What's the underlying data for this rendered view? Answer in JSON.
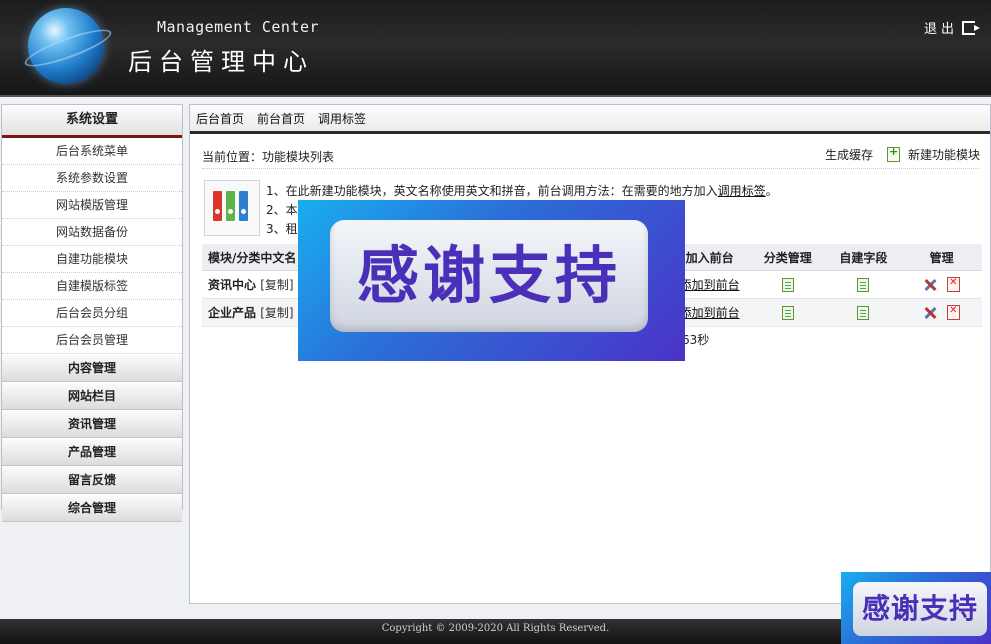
{
  "header": {
    "brand_en": "Management Center",
    "brand_cn": "后台管理中心",
    "logout_label": "退出"
  },
  "sidebar": {
    "title": "系统设置",
    "items": [
      "后台系统菜单",
      "系统参数设置",
      "网站模版管理",
      "网站数据备份",
      "自建功能模块",
      "自建模版标签",
      "后台会员分组",
      "后台会员管理"
    ],
    "groups": [
      "内容管理",
      "网站栏目",
      "资讯管理",
      "产品管理",
      "留言反馈",
      "综合管理"
    ]
  },
  "tabs": [
    "后台首页",
    "前台首页",
    "调用标签"
  ],
  "location": {
    "text": "当前位置：功能模块列表",
    "generate_cache": "生成缓存",
    "new_module": "新建功能模块"
  },
  "tips": {
    "line1_prefix": "1、在此新建功能模块，英文名称使用英文和拼音，前台调用方法：在需要的地方加入",
    "line1_link": "调用标签",
    "line1_suffix": "。",
    "line2": "2、本",
    "line3": "3、租"
  },
  "table": {
    "headers": [
      "模块/分类中文名",
      "加入前台",
      "分类管理",
      "自建字段",
      "管理"
    ],
    "rows": [
      {
        "name": "资讯中心",
        "copy": "[复制]",
        "add_front": "添加到前台"
      },
      {
        "name": "企业产品",
        "copy": "[复制]",
        "add_front": "添加到前台"
      }
    ]
  },
  "runtime_fragment": "63秒",
  "banner_text": "感谢支持",
  "mini_banner_text": "感谢支持",
  "footer": "Copyright © 2009-2020 All Rights Reserved.",
  "colors": {
    "header_bg": "#1c1c1c",
    "sidebar_accent": "#7a1212",
    "banner_blue": "#2b6fd8",
    "banner_text": "#4a2fb8"
  }
}
